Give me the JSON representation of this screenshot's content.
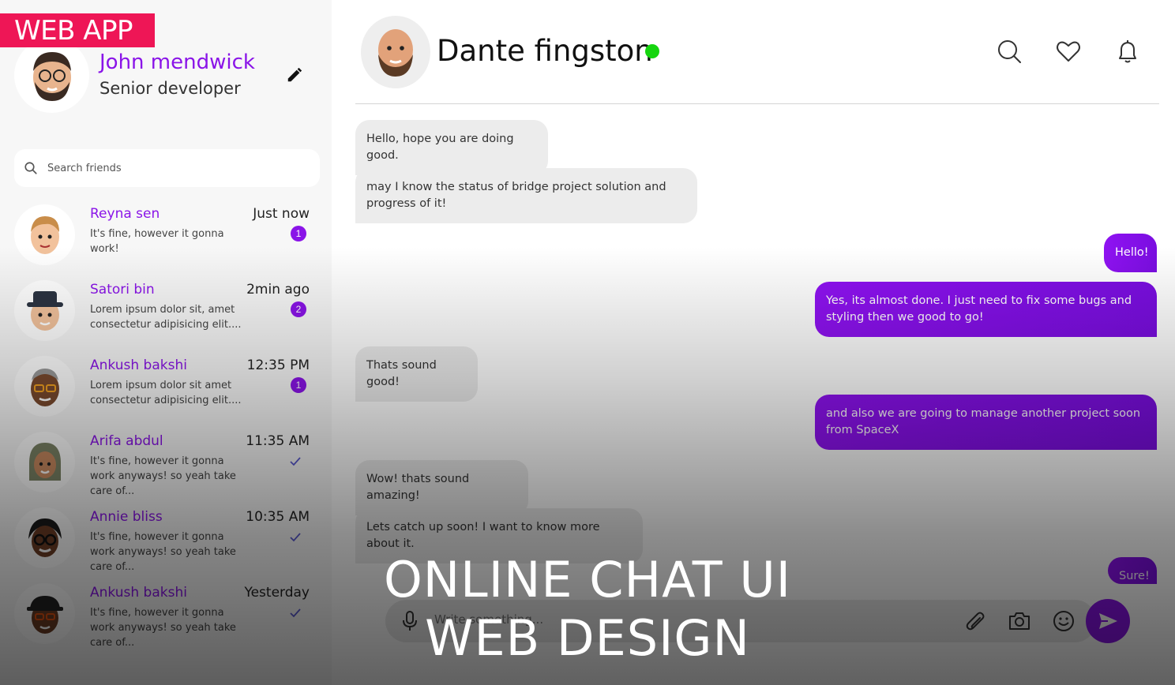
{
  "banner": {
    "label": "WEB APP"
  },
  "profile": {
    "name": "John mendwick",
    "role": "Senior developer"
  },
  "search": {
    "placeholder": "Search friends"
  },
  "contacts": [
    {
      "name": "Reyna sen",
      "time": "Just now",
      "message": "It's fine, however it gonna work!",
      "unread": "1"
    },
    {
      "name": "Satori bin",
      "time": "2min ago",
      "message": "Lorem ipsum dolor sit, amet consectetur adipisicing elit....",
      "unread": "2"
    },
    {
      "name": "Ankush bakshi",
      "time": "12:35 PM",
      "message": "Lorem ipsum dolor sit amet consectetur adipisicing elit....",
      "unread": "1"
    },
    {
      "name": "Arifa abdul",
      "time": "11:35 AM",
      "message": "It's fine, however it gonna work anyways! so yeah take care of..."
    },
    {
      "name": "Annie bliss",
      "time": "10:35 AM",
      "message": "It's fine, however it gonna work anyways! so yeah take care of..."
    },
    {
      "name": "Ankush bakshi",
      "time": "Yesterday",
      "message": "It's fine, however it gonna work anyways! so yeah take care of..."
    }
  ],
  "chat": {
    "name": "Dante fingston",
    "status_color": "#16d50f",
    "messages": [
      {
        "dir": "in",
        "text": "Hello, hope you are doing good."
      },
      {
        "dir": "in",
        "text": "may I know the status of bridge project solution and progress of it!"
      },
      {
        "dir": "out",
        "text": "Hello!"
      },
      {
        "dir": "out",
        "text": "Yes, its almost done. I just need to fix some bugs and styling then we good to go!"
      },
      {
        "dir": "in",
        "text": "Thats sound good!"
      },
      {
        "dir": "out",
        "text": "and also we are going to manage another project soon from SpaceX"
      },
      {
        "dir": "in",
        "text": "Wow! thats sound amazing!"
      },
      {
        "dir": "in",
        "text": "Lets catch up soon! I want to know more about it."
      },
      {
        "dir": "out",
        "text": "Sure!"
      }
    ],
    "input_placeholder": "Write something..."
  },
  "promo": {
    "line1": "ONLINE CHAT UI",
    "line2": "WEB DESIGN"
  },
  "colors": {
    "accent": "#8a14e8",
    "banner": "#ee1656"
  },
  "icons": [
    "pencil-icon",
    "search-icon",
    "heart-icon",
    "bell-icon",
    "checkmark-icon",
    "microphone-icon",
    "paperclip-icon",
    "camera-icon",
    "smiley-icon",
    "send-icon",
    "memoji-avatar"
  ]
}
